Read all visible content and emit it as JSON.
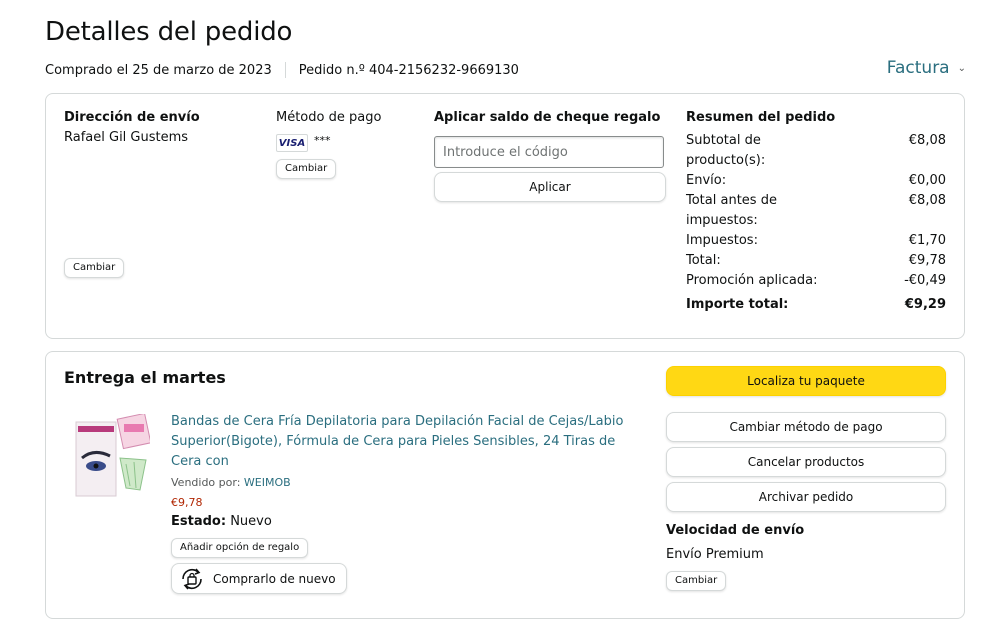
{
  "header": {
    "title": "Detalles del pedido",
    "purchased": "Comprado el 25 de marzo de 2023",
    "order_number": "Pedido n.º 404-2156232-9669130",
    "invoice_label": "Factura"
  },
  "shipping": {
    "heading": "Dirección de envío",
    "name": "Rafael Gil Gustems",
    "change_label": "Cambiar"
  },
  "payment": {
    "heading": "Método de pago",
    "card_brand": "VISA",
    "card_mask": "***",
    "change_label": "Cambiar"
  },
  "giftcard": {
    "heading": "Aplicar saldo de cheque regalo",
    "placeholder": "Introduce el código",
    "apply_label": "Aplicar"
  },
  "summary": {
    "heading": "Resumen del pedido",
    "rows": [
      {
        "label": "Subtotal de producto(s):",
        "value": "€8,08"
      },
      {
        "label": "Envío:",
        "value": "€0,00"
      },
      {
        "label": "Total antes de impuestos:",
        "value": "€8,08"
      },
      {
        "label": "Impuestos:",
        "value": "€1,70"
      },
      {
        "label": "Total:",
        "value": "€9,78"
      },
      {
        "label": "Promoción aplicada:",
        "value": "-€0,49"
      }
    ],
    "total_label": "Importe total:",
    "total_value": "€9,29"
  },
  "delivery": {
    "heading": "Entrega el martes",
    "product": {
      "title": "Bandas de Cera Fría Depilatoria para Depilación Facial de Cejas/Labio Superior(Bigote), Fórmula de Cera para Pieles Sensibles, 24 Tiras de Cera con",
      "sold_by_label": "Vendido por:",
      "seller": "WEIMOB",
      "price": "€9,78",
      "condition_label": "Estado:",
      "condition_value": "Nuevo",
      "gift_label": "Añadir opción de regalo",
      "buy_again_label": "Comprarlo de nuevo",
      "image_icon": "wax-strips-product-image"
    },
    "actions": {
      "track": "Localiza tu paquete",
      "change_payment": "Cambiar método de pago",
      "cancel": "Cancelar productos",
      "archive": "Archivar pedido"
    },
    "speed_heading": "Velocidad de envío",
    "speed_value": "Envío Premium",
    "speed_change": "Cambiar"
  },
  "colors": {
    "link": "#2a6e7f",
    "price": "#b12704",
    "primary_button": "#ffd814",
    "border": "#d5d9d9"
  }
}
